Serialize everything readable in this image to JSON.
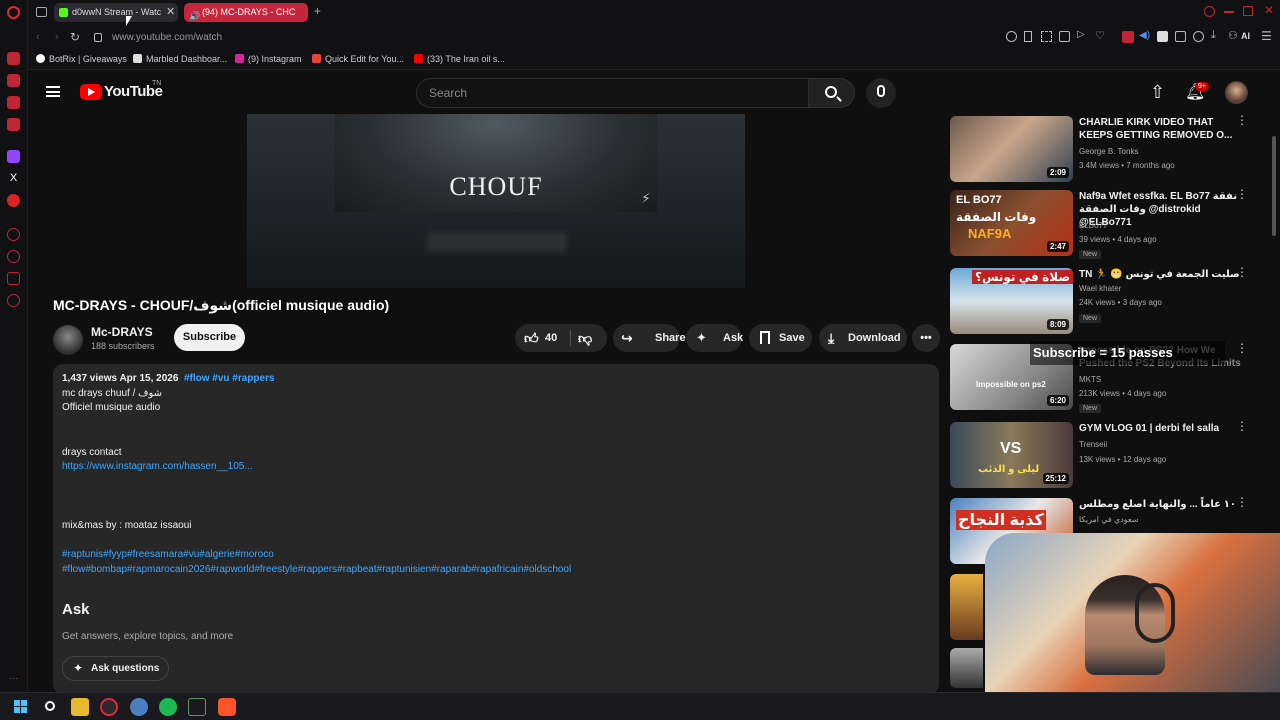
{
  "browser": {
    "tabs": [
      {
        "label": "d0wwN Stream - Watc",
        "active": true
      },
      {
        "label": "(94) MC-DRAYS - CHC",
        "active": false,
        "color": "#c4273d"
      }
    ],
    "url": "www.youtube.com/watch",
    "bookmarks": [
      "BotRix | Giveaways",
      "Marbled Dashboar...",
      "(9) Instagram",
      "Quick Edit for You...",
      "(33) The Iran oil s..."
    ],
    "ai_label": "AI"
  },
  "youtube": {
    "logo_text": "YouTube",
    "logo_region": "TN",
    "search_placeholder": "Search",
    "notif_count": "9+",
    "video": {
      "thumb_title": "CHOUF",
      "title": "MC-DRAYS - CHOUF/شوف(officiel musique audio)",
      "channel": "Mc-DRAYS",
      "subscribers": "188 subscribers",
      "subscribe": "Subscribe",
      "likes": "40",
      "share": "Share",
      "ask": "Ask",
      "save": "Save",
      "download": "Download"
    },
    "description": {
      "meta": "1,437 views  Apr 15, 2026",
      "meta_tags": "#flow #vu #rappers",
      "line1": "mc drays chuuf / شوف",
      "line2": "Officiel musique audio",
      "contact_label": "drays contact",
      "link": "https://www.instagram.com/hassen__105...",
      "mix": "mix&mas by : moataz issaoui",
      "tags1": "#raptunis#fyyp#freesamara#vu#algerie#moroco",
      "tags2": "#flow#bombap#rapmarocain2026#rapworld#freestyle#rappers#rapbeat#raptunisien#raparab#rapafricain#oldschool",
      "ask_heading": "Ask",
      "ask_sub": "Get answers, explore topics, and more",
      "ask_button": "Ask questions"
    },
    "recommendations": [
      {
        "title": "CHARLIE KIRK VIDEO THAT KEEPS GETTING REMOVED O...",
        "channel": "George B. Tonks",
        "meta": "3.4M views • 7 months ago",
        "duration": "2:09",
        "new": ""
      },
      {
        "title": "Naf9a Wfet essfka. EL Bo77 نفقة وفات الصفقة @distrokid @ELBo771",
        "channel": "ELBo77",
        "meta": "39 views • 4 days ago",
        "duration": "2:47",
        "new": "New"
      },
      {
        "title": "TN 🏃 😬 صليت الجمعة في تونس",
        "channel": "Wael khater",
        "meta": "24K views • 3 days ago",
        "duration": "8:09",
        "new": "New"
      },
      {
        "title": "Impossible on PS2? How We Pushed the PS2 Beyond Its Limits",
        "channel": "MKTS",
        "meta": "213K views • 4 days ago",
        "duration": "6:20",
        "new": "New"
      },
      {
        "title": "GYM VLOG 01 | derbi fel salla",
        "channel": "Trenseii",
        "meta": "13K views • 12 days ago",
        "duration": "25:12",
        "new": ""
      },
      {
        "title": "١٠ عاماً ... والنهاية اصلع ومطلس",
        "channel": "سعودي في امريكا",
        "meta": "",
        "duration": "",
        "new": ""
      }
    ],
    "thumb_texts": {
      "t2a": "EL BO77",
      "t2b": "وفات الصفقة",
      "t2c": "NAF9A",
      "t3": "صلاة في تونس؟",
      "t4": "Impossible on ps2",
      "t5a": "VS",
      "t5b": "ليلى و الذئب",
      "t6": "كذبة النجاح"
    }
  },
  "stream_overlay": "Subscribe = 15 passes"
}
